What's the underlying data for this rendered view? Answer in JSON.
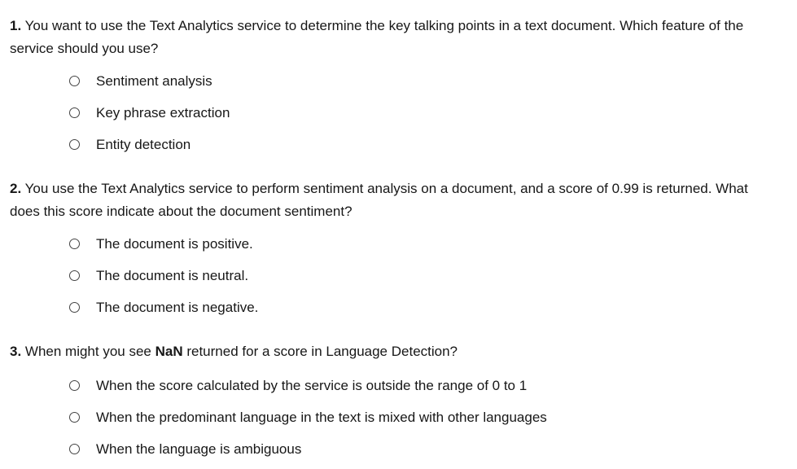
{
  "questions": [
    {
      "number": "1.",
      "text": " You want to use the Text Analytics service to determine the key talking points in a text document. Which feature of the service should you use?",
      "options": [
        "Sentiment analysis",
        "Key phrase extraction",
        "Entity detection"
      ]
    },
    {
      "number": "2.",
      "text": " You use the Text Analytics service to perform sentiment analysis on a document, and a score of 0.99 is returned. What does this score indicate about the document sentiment?",
      "options": [
        "The document is positive.",
        "The document is neutral.",
        "The document is negative."
      ]
    },
    {
      "number": "3.",
      "text_before": " When might you see ",
      "text_bold": "NaN",
      "text_after": " returned for a score in Language Detection?",
      "options": [
        "When the score calculated by the service is outside the range of 0 to 1",
        "When the predominant language in the text is mixed with other languages",
        "When the language is ambiguous"
      ]
    }
  ]
}
